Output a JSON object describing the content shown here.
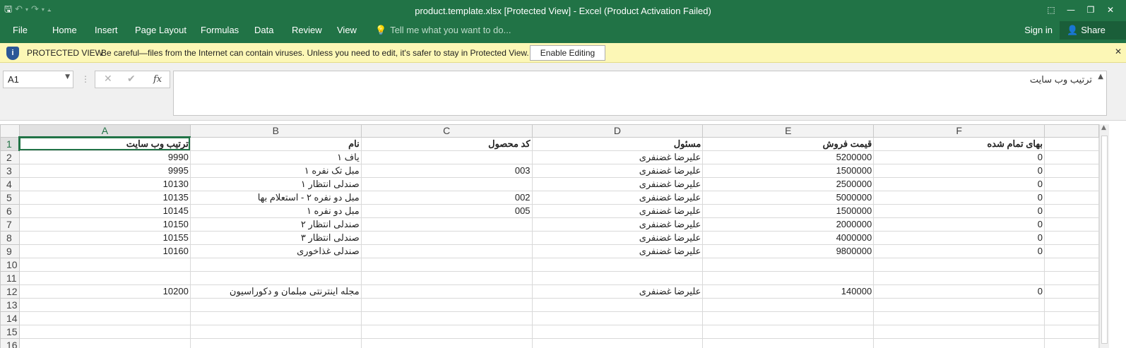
{
  "window": {
    "title": "product.template.xlsx  [Protected View] - Excel (Product Activation Failed)",
    "qat": {
      "save_icon": "save-icon",
      "undo_icon": "undo-icon",
      "redo_icon": "redo-icon",
      "customize_icon": "customize-qat-icon"
    },
    "controls": [
      "ribbon-display-icon",
      "minimize-icon",
      "restore-icon",
      "close-icon"
    ]
  },
  "ribbon": {
    "tabs": [
      "File",
      "Home",
      "Insert",
      "Page Layout",
      "Formulas",
      "Data",
      "Review",
      "View"
    ],
    "tell_me": "Tell me what you want to do...",
    "sign_in": "Sign in",
    "share": "Share"
  },
  "protected_view": {
    "title": "PROTECTED VIEW",
    "message": "Be careful—files from the Internet can contain viruses. Unless you need to edit, it's safer to stay in Protected View.",
    "enable_button": "Enable Editing"
  },
  "formula_bar": {
    "name_box": "A1",
    "formula": "ترتیب وب سایت"
  },
  "sheet": {
    "columns": [
      "A",
      "B",
      "C",
      "D",
      "E",
      "F"
    ],
    "selected_column": "A",
    "selected_row": "1",
    "rows": [
      {
        "num": "1",
        "cells": [
          "ترتیب وب سایت",
          "نام",
          "کد محصول",
          "مسئول",
          "قیمت فروش",
          "بهای تمام شده"
        ]
      },
      {
        "num": "2",
        "cells": [
          "9990",
          "یاف ۱",
          "",
          "علیرضا غضنفری",
          "5200000",
          "0"
        ]
      },
      {
        "num": "3",
        "cells": [
          "9995",
          "مبل تک نفره ۱",
          "003",
          "علیرضا غضنفری",
          "1500000",
          "0"
        ]
      },
      {
        "num": "4",
        "cells": [
          "10130",
          "صندلی انتظار ۱",
          "",
          "علیرضا غضنفری",
          "2500000",
          "0"
        ]
      },
      {
        "num": "5",
        "cells": [
          "10135",
          "مبل دو نفره ۲ - استعلام بها",
          "002",
          "علیرضا غضنفری",
          "5000000",
          "0"
        ]
      },
      {
        "num": "6",
        "cells": [
          "10145",
          "مبل دو نفره ۱",
          "005",
          "علیرضا غضنفری",
          "1500000",
          "0"
        ]
      },
      {
        "num": "7",
        "cells": [
          "10150",
          "صندلی انتظار ۲",
          "",
          "علیرضا غضنفری",
          "2000000",
          "0"
        ]
      },
      {
        "num": "8",
        "cells": [
          "10155",
          "صندلی انتظار ۳",
          "",
          "علیرضا غضنفری",
          "4000000",
          "0"
        ]
      },
      {
        "num": "9",
        "cells": [
          "10160",
          "صندلی غذاخوری",
          "",
          "علیرضا غضنفری",
          "9800000",
          "0"
        ]
      },
      {
        "num": "10",
        "cells": [
          "",
          "",
          "",
          "",
          "",
          ""
        ]
      },
      {
        "num": "11",
        "cells": [
          "",
          "",
          "",
          "",
          "",
          ""
        ]
      },
      {
        "num": "12",
        "cells": [
          "10200",
          "مجله اینترنتی مبلمان و دکوراسیون",
          "",
          "علیرضا غضنفری",
          "140000",
          "0"
        ]
      },
      {
        "num": "13",
        "cells": [
          "",
          "",
          "",
          "",
          "",
          ""
        ]
      },
      {
        "num": "14",
        "cells": [
          "",
          "",
          "",
          "",
          "",
          ""
        ]
      },
      {
        "num": "15",
        "cells": [
          "",
          "",
          "",
          "",
          "",
          ""
        ]
      },
      {
        "num": "16",
        "cells": [
          "",
          "",
          "",
          "",
          "",
          ""
        ]
      }
    ]
  },
  "colors": {
    "excel_green": "#217346",
    "pv_bar": "#fcf7b6",
    "shield_blue": "#2b5797"
  }
}
